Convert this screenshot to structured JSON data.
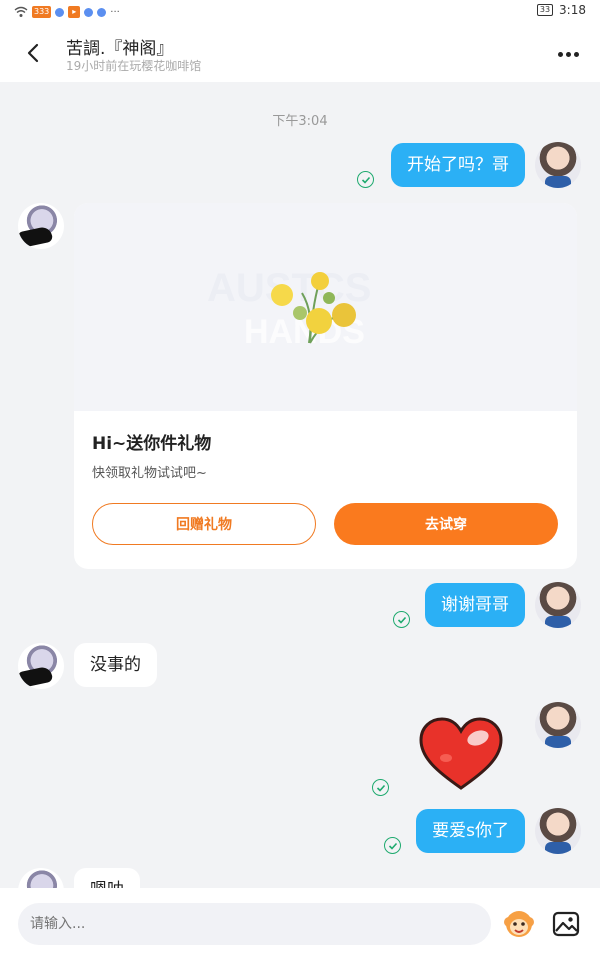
{
  "status_bar": {
    "network_badge": "333",
    "ellipsis": "···",
    "battery": "33",
    "time": "3:18"
  },
  "header": {
    "title": "苦調.『神阁』",
    "subtitle": "19小时前在玩樱花咖啡馆"
  },
  "chat": {
    "timestamp": "下午3:04",
    "messages": [
      {
        "from": "me",
        "text": "开始了吗？哥"
      },
      {
        "from": "other",
        "type": "gift_card"
      },
      {
        "from": "me",
        "text": "谢谢哥哥"
      },
      {
        "from": "other",
        "text": "没事的"
      },
      {
        "from": "me",
        "type": "sticker",
        "sticker": "red-heart"
      },
      {
        "from": "me",
        "text": "要爱s你了"
      },
      {
        "from": "other",
        "text": "嗯呐"
      }
    ]
  },
  "gift_card": {
    "title": "Hi~送你件礼物",
    "subtitle": "快领取礼物试试吧~",
    "return_label": "回赠礼物",
    "try_label": "去试穿"
  },
  "input": {
    "placeholder": "请输入..."
  },
  "colors": {
    "bubble_me": "#2bb0f5",
    "accent_orange": "#fa7a1e",
    "read_check": "#1faa6f"
  }
}
